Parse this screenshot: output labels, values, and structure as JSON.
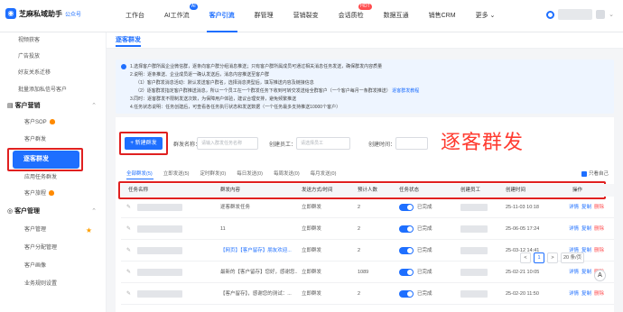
{
  "brand": {
    "name": "芝麻私域助手",
    "sub": "公众号"
  },
  "nav": [
    {
      "label": "工作台"
    },
    {
      "label": "AI工作流",
      "badge": "AI"
    },
    {
      "label": "客户引流"
    },
    {
      "label": "群管理"
    },
    {
      "label": "营销裂变"
    },
    {
      "label": "会话质检",
      "badge": "HOT"
    },
    {
      "label": "数据互通"
    },
    {
      "label": "销售CRM"
    },
    {
      "label": "更多"
    }
  ],
  "sidebar": {
    "top_items": [
      "视频获客",
      "广告投放",
      "好友关系迁移",
      "批量添加私信号客户"
    ],
    "group1": "客户营销",
    "group1_items": [
      "客户SOP",
      "客户群发",
      "逐客群发",
      "应用任务群发",
      "客户旅程"
    ],
    "group2": "客户管理",
    "group2_items": [
      "客户管理",
      "客户分配管理",
      "客户画像",
      "业务规则设置"
    ]
  },
  "breadcrumb": "逐客群发",
  "notice": [
    "1.选择客户群所属企业微信群，逐条向客户群分组消息推送；只有客户群所属成员可通过相关消息任务发送，确保群发内容质量",
    "2.说明：逐条推送、企业成员逐一确认发送后，消息内容推送至客户群",
    "（1）客户群发消息活动：默认发送客户群名，选择消息类型后，填写推送内容及链接信息",
    "（2）逐客群发指定客户群推送消息，所以一个员工在一个群发任务下收到可转交发送给全群客户（一个客户每月一条群发推送）",
    "3.同时：逐客群发不限制发送次数，为保障用户体验，建议合理安排，避免频繁推送",
    "4.任务状态说明：任务创建后，可查看各任务执行状态和发送数据（一个任务最多支持推送10000个客户）"
  ],
  "notice_link": "逐客群发教程",
  "add_button": "+ 新建群发",
  "filters": {
    "task_label": "群发名称：",
    "task_ph": "请输入群发任务名称",
    "creator_label": "创建员工：",
    "creator_ph": "请选择员工",
    "time_label": "创建时间："
  },
  "overlay_title": "逐客群发",
  "tabs": [
    "全部群发(5)",
    "立即发送(5)",
    "定时群发(0)",
    "每日发送(0)",
    "每周发送(0)",
    "每月发送(0)"
  ],
  "show_own": "只看自己",
  "columns": [
    "任务名称",
    "群发内容",
    "发送方式/时间",
    "预计人数",
    "任务状态",
    "创建员工",
    "创建时间",
    "操作"
  ],
  "rows": [
    {
      "content": "逐客群发任务",
      "method": "立即群发",
      "count": "2",
      "status": "已完成",
      "time": "25-11-03 10:18"
    },
    {
      "content": "11",
      "method": "立即群发",
      "count": "2",
      "status": "已完成",
      "time": "25-06-05 17:24"
    },
    {
      "content": "【网页】【客户留存】朋友欢迎...",
      "method": "立即群发",
      "count": "2",
      "status": "已完成",
      "time": "25-03-12 14:41"
    },
    {
      "content": "最新的【客户留存】您好，感谢您...",
      "method": "立即群发",
      "count": "1089",
      "status": "已完成",
      "time": "25-02-21 10:05"
    },
    {
      "content": "【客户留存】，感谢您的测试：...",
      "method": "立即群发",
      "count": "2",
      "status": "已完成",
      "time": "25-02-20 11:50"
    }
  ],
  "row_actions": [
    "详情",
    "复制",
    "删除"
  ],
  "pager": {
    "prev": "<",
    "page": "1",
    "next": ">",
    "size": "20 条/页"
  },
  "colors": {
    "accent": "#1e6fff",
    "alert": "#e02020"
  }
}
